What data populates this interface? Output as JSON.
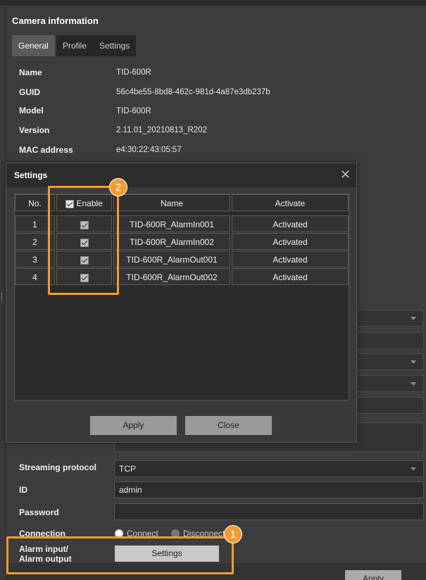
{
  "camera_info": {
    "title": "Camera information",
    "tabs": [
      {
        "label": "General"
      },
      {
        "label": "Profile"
      },
      {
        "label": "Settings"
      }
    ],
    "fields": [
      {
        "label": "Name",
        "value": "TID-600R"
      },
      {
        "label": "GUID",
        "value": "56c4be55-8bd8-462c-981d-4a87e3db237b"
      },
      {
        "label": "Model",
        "value": "TID-600R"
      },
      {
        "label": "Version",
        "value": "2.11.01_20210813_R202"
      },
      {
        "label": "MAC address",
        "value": "e4:30:22:43:05:57"
      }
    ]
  },
  "form": {
    "streaming_protocol_label": "Streaming protocol",
    "streaming_protocol_value": "TCP",
    "id_label": "ID",
    "id_value": "admin",
    "password_label": "Password",
    "password_value": "",
    "connection_label": "Connection",
    "connect_option": "Connect",
    "disconnect_option": "Disconnect",
    "alarm_label_line1": "Alarm input/",
    "alarm_label_line2": "Alarm output",
    "settings_button": "Settings",
    "apply_button": "Apply"
  },
  "modal": {
    "title": "Settings",
    "columns": {
      "no": "No.",
      "enable": "Enable",
      "name": "Name",
      "activate": "Activate"
    },
    "rows": [
      {
        "no": "1",
        "enabled": true,
        "name": "TID-600R_AlarmIn001",
        "activate": "Activated"
      },
      {
        "no": "2",
        "enabled": true,
        "name": "TID-600R_AlarmIn002",
        "activate": "Activated"
      },
      {
        "no": "3",
        "enabled": true,
        "name": "TID-600R_AlarmOut001",
        "activate": "Activated"
      },
      {
        "no": "4",
        "enabled": true,
        "name": "TID-600R_AlarmOut002",
        "activate": "Activated"
      }
    ],
    "apply_button": "Apply",
    "close_button": "Close"
  },
  "callouts": [
    {
      "number": "1"
    },
    {
      "number": "2"
    }
  ],
  "colors": {
    "accent": "#f39c31",
    "panel_bg": "#3c3c3c",
    "header_bg": "#2c2c2c"
  }
}
